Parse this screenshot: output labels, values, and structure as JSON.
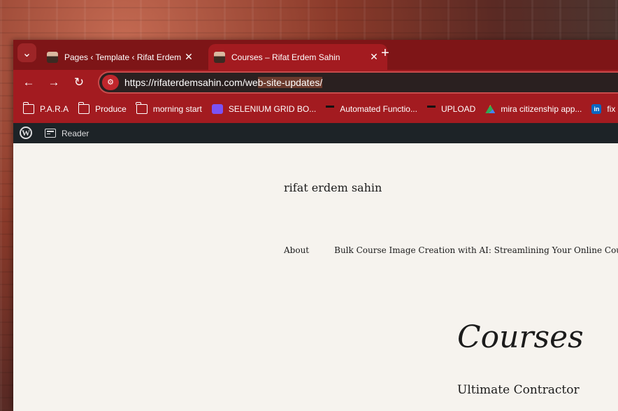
{
  "tabs": [
    {
      "title": "Pages ‹ Template ‹ Rifat Erdem S",
      "close": "✕"
    },
    {
      "title": "Courses – Rifat Erdem Sahin",
      "close": "✕"
    }
  ],
  "new_tab": "+",
  "tab_menu_icon": "⌄",
  "toolbar": {
    "back": "←",
    "forward": "→",
    "reload": "↻",
    "site_info": "⚙"
  },
  "url": {
    "prefix": "https://rifaterdemsahin.com/we",
    "selected": "b-site-updates/"
  },
  "bookmarks": [
    {
      "label": "P.A.R.A",
      "icon": "folder"
    },
    {
      "label": "Produce",
      "icon": "folder"
    },
    {
      "label": "morning start",
      "icon": "folder"
    },
    {
      "label": "SELENIUM GRID BO...",
      "icon": "video",
      "color": "#7b52f5"
    },
    {
      "label": "Automated Functio...",
      "icon": "task-pin"
    },
    {
      "label": "UPLOAD",
      "icon": "task-pin"
    },
    {
      "label": "mira citizenship app...",
      "icon": "drive",
      "color": "#34a853"
    },
    {
      "label": "fix",
      "icon": "linkedin",
      "color": "#0a66c2"
    }
  ],
  "wpbar": {
    "reader": "Reader"
  },
  "site": {
    "title": "rifat erdem sahin",
    "nav": [
      "About",
      "Bulk Course Image Creation with AI: Streamlining Your Online Cours"
    ]
  },
  "page": {
    "heading": "Courses",
    "subheading": "Ultimate Contractor"
  },
  "colors": {
    "tabstrip": "#7e1517",
    "toolbar": "#a31b20",
    "wpbar": "#1d2327",
    "page_bg": "#f6f3ee"
  }
}
